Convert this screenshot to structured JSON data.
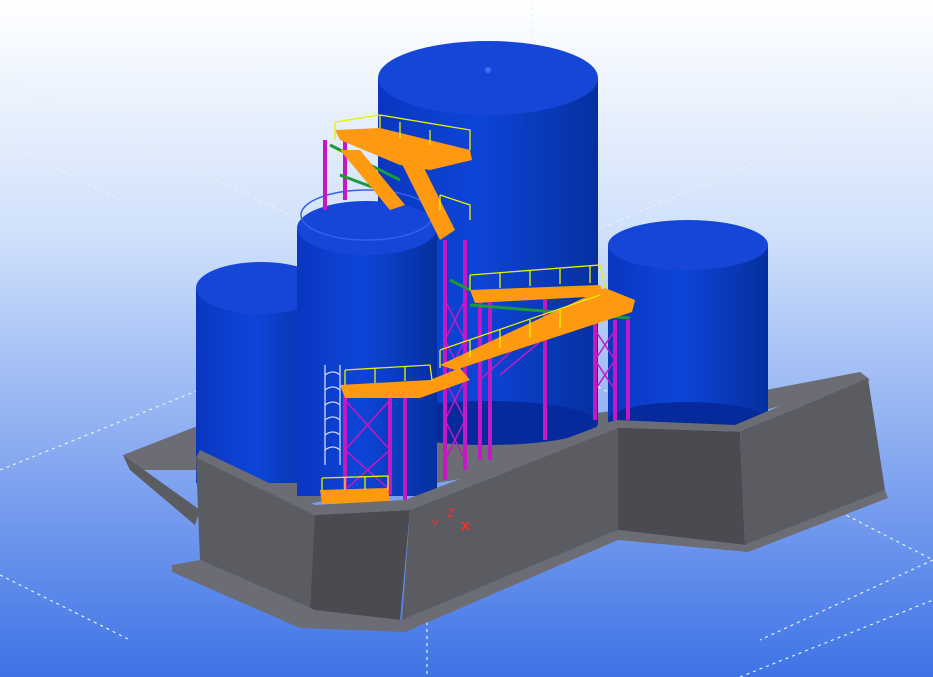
{
  "viewport": {
    "background_top": "#ffffff",
    "background_bottom": "#3f73e6",
    "grid_line_color": "#e8f4ea"
  },
  "colors": {
    "tank": "#0a3fd0",
    "tank_dark": "#062a9c",
    "tank_top": "#1546d8",
    "concrete_front": "#4a4a50",
    "concrete_side": "#5b5b62",
    "concrete_top": "#6c6c74",
    "steel_column": "#c418c4",
    "walkway_deck": "#ff9a10",
    "handrail": "#e8f000",
    "bracing": "#1a9a3a"
  },
  "coordinate_axes": {
    "y_label": "Y",
    "z_label": "Z",
    "x_label": "X"
  }
}
